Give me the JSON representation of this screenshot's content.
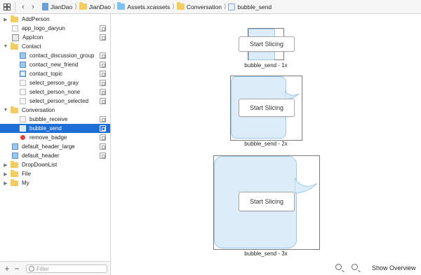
{
  "jumpbar": {
    "crumbs": [
      "JianDao",
      "JianDao",
      "Assets.xcassets",
      "Conversation",
      "bubble_send"
    ]
  },
  "sidebar": {
    "items": [
      {
        "label": "AddPerson",
        "kind": "folder",
        "disclosure": "▶"
      },
      {
        "label": "app_logo_daryun",
        "kind": "image"
      },
      {
        "label": "AppIcon",
        "kind": "appicon"
      },
      {
        "label": "Contact",
        "kind": "folder",
        "disclosure": "▼"
      },
      {
        "label": "contact_discussion_group",
        "kind": "image-blue"
      },
      {
        "label": "contact_new_friend",
        "kind": "image-blue"
      },
      {
        "label": "contact_topic",
        "kind": "image-ring"
      },
      {
        "label": "select_person_gray",
        "kind": "image"
      },
      {
        "label": "select_person_none",
        "kind": "image"
      },
      {
        "label": "select_person_selected",
        "kind": "image"
      },
      {
        "label": "Conversation",
        "kind": "folder",
        "disclosure": "▼"
      },
      {
        "label": "bubble_receive",
        "kind": "image"
      },
      {
        "label": "bubble_send",
        "kind": "image",
        "selected": true
      },
      {
        "label": "remove_badge",
        "kind": "badge"
      },
      {
        "label": "default_header_large",
        "kind": "image-blue"
      },
      {
        "label": "default_header",
        "kind": "image-blue"
      },
      {
        "label": "DropDownList",
        "kind": "folder",
        "disclosure": "▶"
      },
      {
        "label": "File",
        "kind": "folder",
        "disclosure": "▶"
      },
      {
        "label": "My",
        "kind": "folder",
        "disclosure": "▶"
      }
    ],
    "filter_placeholder": "Filter"
  },
  "canvas": {
    "slots": [
      {
        "label": "bubble_send - 1x",
        "button": "Start Slicing"
      },
      {
        "label": "bubble_send - 2x",
        "button": "Start Slicing"
      },
      {
        "label": "bubble_send - 3x",
        "button": "Start Slicing"
      }
    ],
    "show_overview": "Show Overview"
  },
  "colors": {
    "selection": "#1f6ed5",
    "bubble_fill": "#dcecf9",
    "bubble_stroke": "#9cc9ee",
    "folder": "#f3cd5f"
  }
}
